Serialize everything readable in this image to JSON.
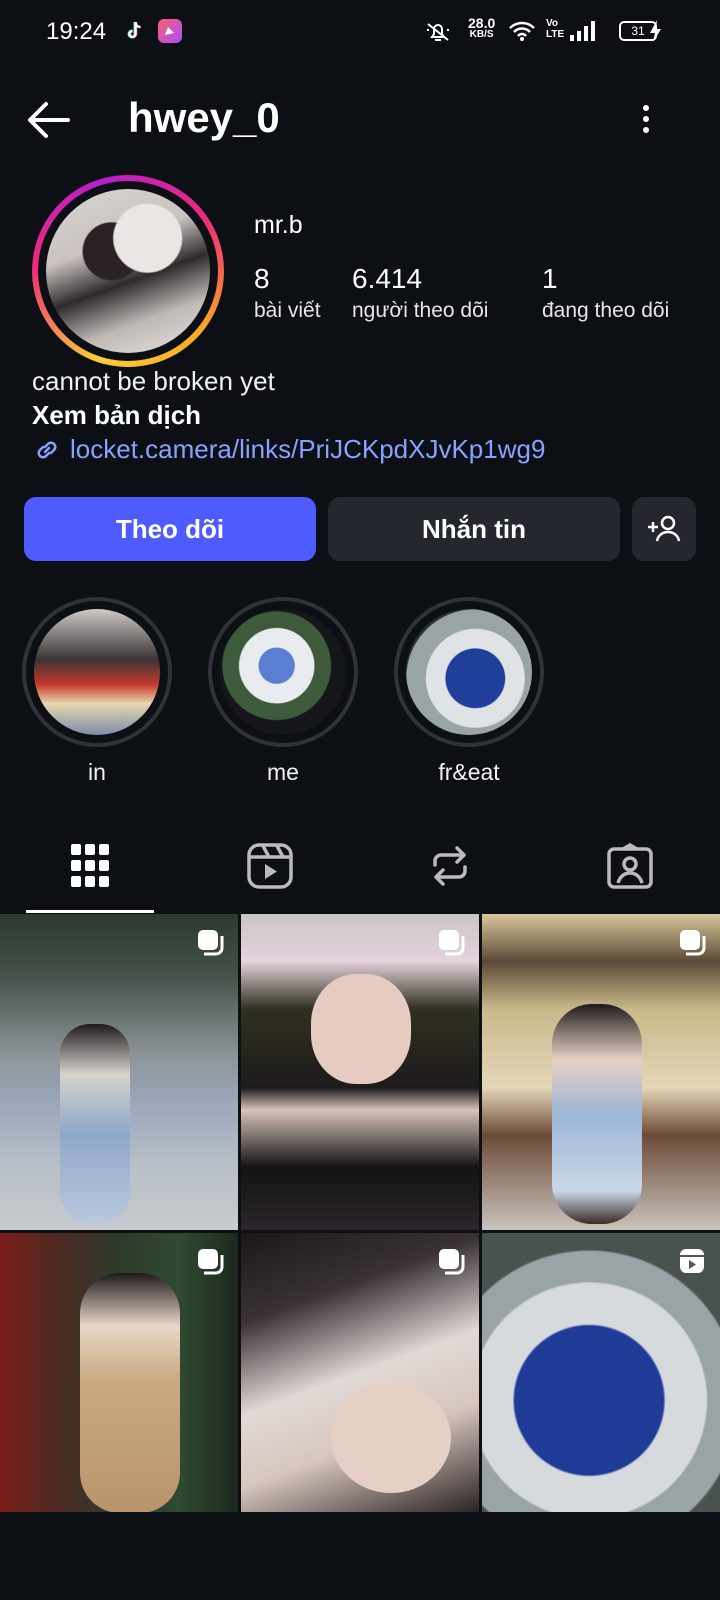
{
  "status_bar": {
    "time": "19:24",
    "net_speed": "28.0",
    "net_unit": "KB/S",
    "volte": "Vo LTE",
    "battery": "31"
  },
  "header": {
    "username": "hwey_0"
  },
  "profile": {
    "full_name": "mr.b",
    "stats": [
      {
        "value": "8",
        "label": "bài viết"
      },
      {
        "value": "6.414",
        "label": "người theo dõi"
      },
      {
        "value": "1",
        "label": "đang theo dõi"
      }
    ],
    "bio": "cannot be broken yet",
    "translate_label": "Xem bản dịch",
    "link": "locket.camera/links/PriJCKpdXJvKp1wg9"
  },
  "actions": {
    "follow_label": "Theo dõi",
    "message_label": "Nhắn tin"
  },
  "highlights": [
    {
      "name": "in"
    },
    {
      "name": "me"
    },
    {
      "name": "fr&eat"
    }
  ],
  "tabs": [
    "grid-icon",
    "reels-icon",
    "reposts-icon",
    "tagged-icon"
  ],
  "colors": {
    "background": "#0c0f14",
    "follow_button": "#4e5bff",
    "secondary_button": "#24272d",
    "link": "#8aa2ff"
  }
}
